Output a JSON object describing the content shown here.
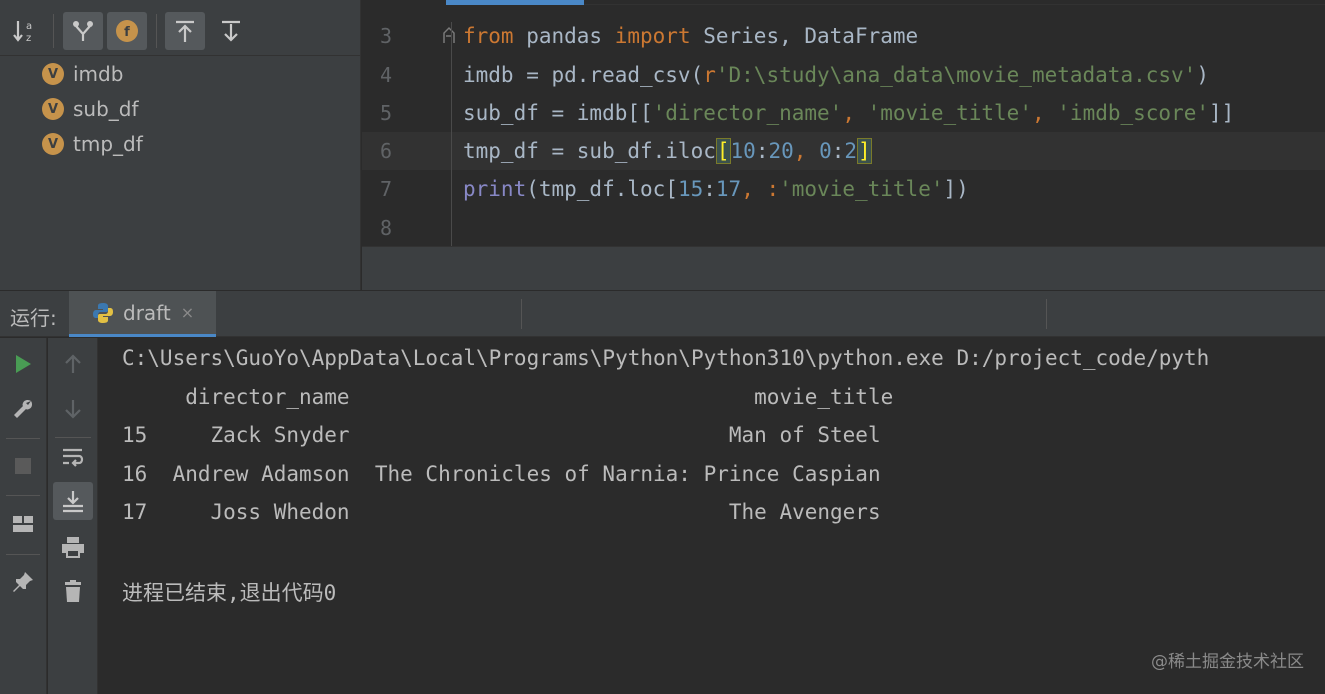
{
  "structure": {
    "toolbar": {
      "sort_alpha_icon": "sort-alpha-icon",
      "group_icon": "group-icon",
      "show_fields_icon": "show-fields-icon",
      "expand_icon": "expand-all-icon",
      "collapse_icon": "collapse-all-icon"
    },
    "items": [
      {
        "badge": "V",
        "label": "imdb"
      },
      {
        "badge": "V",
        "label": "sub_df"
      },
      {
        "badge": "V",
        "label": "tmp_df"
      }
    ]
  },
  "editor": {
    "lines": [
      {
        "num": "3"
      },
      {
        "num": "4"
      },
      {
        "num": "5"
      },
      {
        "num": "6"
      },
      {
        "num": "7"
      },
      {
        "num": "8"
      }
    ],
    "line3": {
      "kw_from": "from",
      "mod": " pandas ",
      "kw_import": "import",
      "names": " Series, DataFrame"
    },
    "line4": {
      "a": "imdb = pd.read_csv(",
      "prefix": "r",
      "path": "'D:\\study\\ana_data\\movie_metadata.csv'",
      "b": ")"
    },
    "line5": {
      "a": "sub_df = imdb[[",
      "s1": "'director_name'",
      "c1": ", ",
      "s2": "'movie_title'",
      "c2": ", ",
      "s3": "'imdb_score'",
      "b": "]]"
    },
    "line6": {
      "a": "tmp_df = sub_df.iloc",
      "lb": "[",
      "n1": "10",
      "colon1": ":",
      "n2": "20",
      "comma": ", ",
      "n3": "0",
      "colon2": ":",
      "n4": "2",
      "rb": "]"
    },
    "line7": {
      "fn": "print",
      "a": "(tmp_df.loc[",
      "n1": "15",
      "colon": ":",
      "n2": "17",
      "comma": ", :",
      "s": "'movie_title'",
      "b": "])"
    }
  },
  "run": {
    "label": "运行:",
    "tab": {
      "name": "draft",
      "close": "×"
    }
  },
  "console": {
    "lines": [
      "C:\\Users\\GuoYo\\AppData\\Local\\Programs\\Python\\Python310\\python.exe D:/project_code/pyth",
      "     director_name                                movie_title",
      "15     Zack Snyder                              Man of Steel",
      "16  Andrew Adamson  The Chronicles of Narnia: Prince Caspian",
      "17     Joss Whedon                              The Avengers",
      "",
      "进程已结束,退出代码0"
    ]
  },
  "watermark": "@稀土掘金技术社区",
  "colors": {
    "accent": "#4a88c7",
    "run_green": "#499c54",
    "badge": "#c6934b"
  }
}
